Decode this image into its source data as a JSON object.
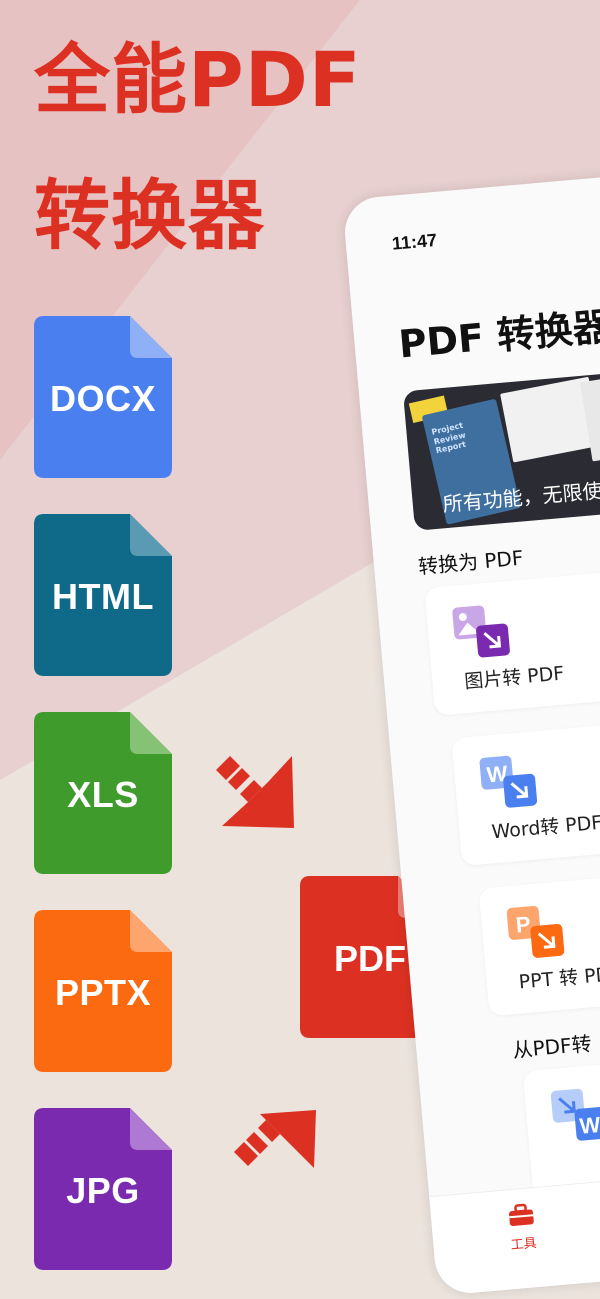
{
  "headline": {
    "line1": "全能PDF",
    "line2": "转换器"
  },
  "file_types": [
    {
      "label": "DOCX",
      "color": "#4a7ff0",
      "fold": "#8fb0f6"
    },
    {
      "label": "HTML",
      "color": "#0f6a8a",
      "fold": "#5a9ab3"
    },
    {
      "label": "XLS",
      "color": "#3f9c2c",
      "fold": "#86c276"
    },
    {
      "label": "PPTX",
      "color": "#fb6a10",
      "fold": "#fda56c"
    },
    {
      "label": "JPG",
      "color": "#7a2aaf",
      "fold": "#ae79d2"
    }
  ],
  "target": {
    "label": "PDF",
    "color": "#dc3122",
    "fold": "#ec8077"
  },
  "accent_color": "#dc3122",
  "phone": {
    "status_time": "11:47",
    "app_title": "PDF 转换器",
    "banner": {
      "report_title": "Project Review Report",
      "text": "所有功能，无限使"
    },
    "section_to_pdf": "转换为 PDF",
    "tools_to_pdf": [
      {
        "label": "图片转 PDF",
        "icon": "image-to-pdf-icon"
      },
      {
        "label": "Word转 PDF",
        "icon": "word-to-pdf-icon"
      },
      {
        "label": "PPT 转 PD",
        "icon": "ppt-to-pdf-icon"
      }
    ],
    "section_from_pdf": "从PDF转",
    "tabbar": {
      "tools_label": "工具",
      "tools_icon": "toolbox-icon"
    }
  }
}
